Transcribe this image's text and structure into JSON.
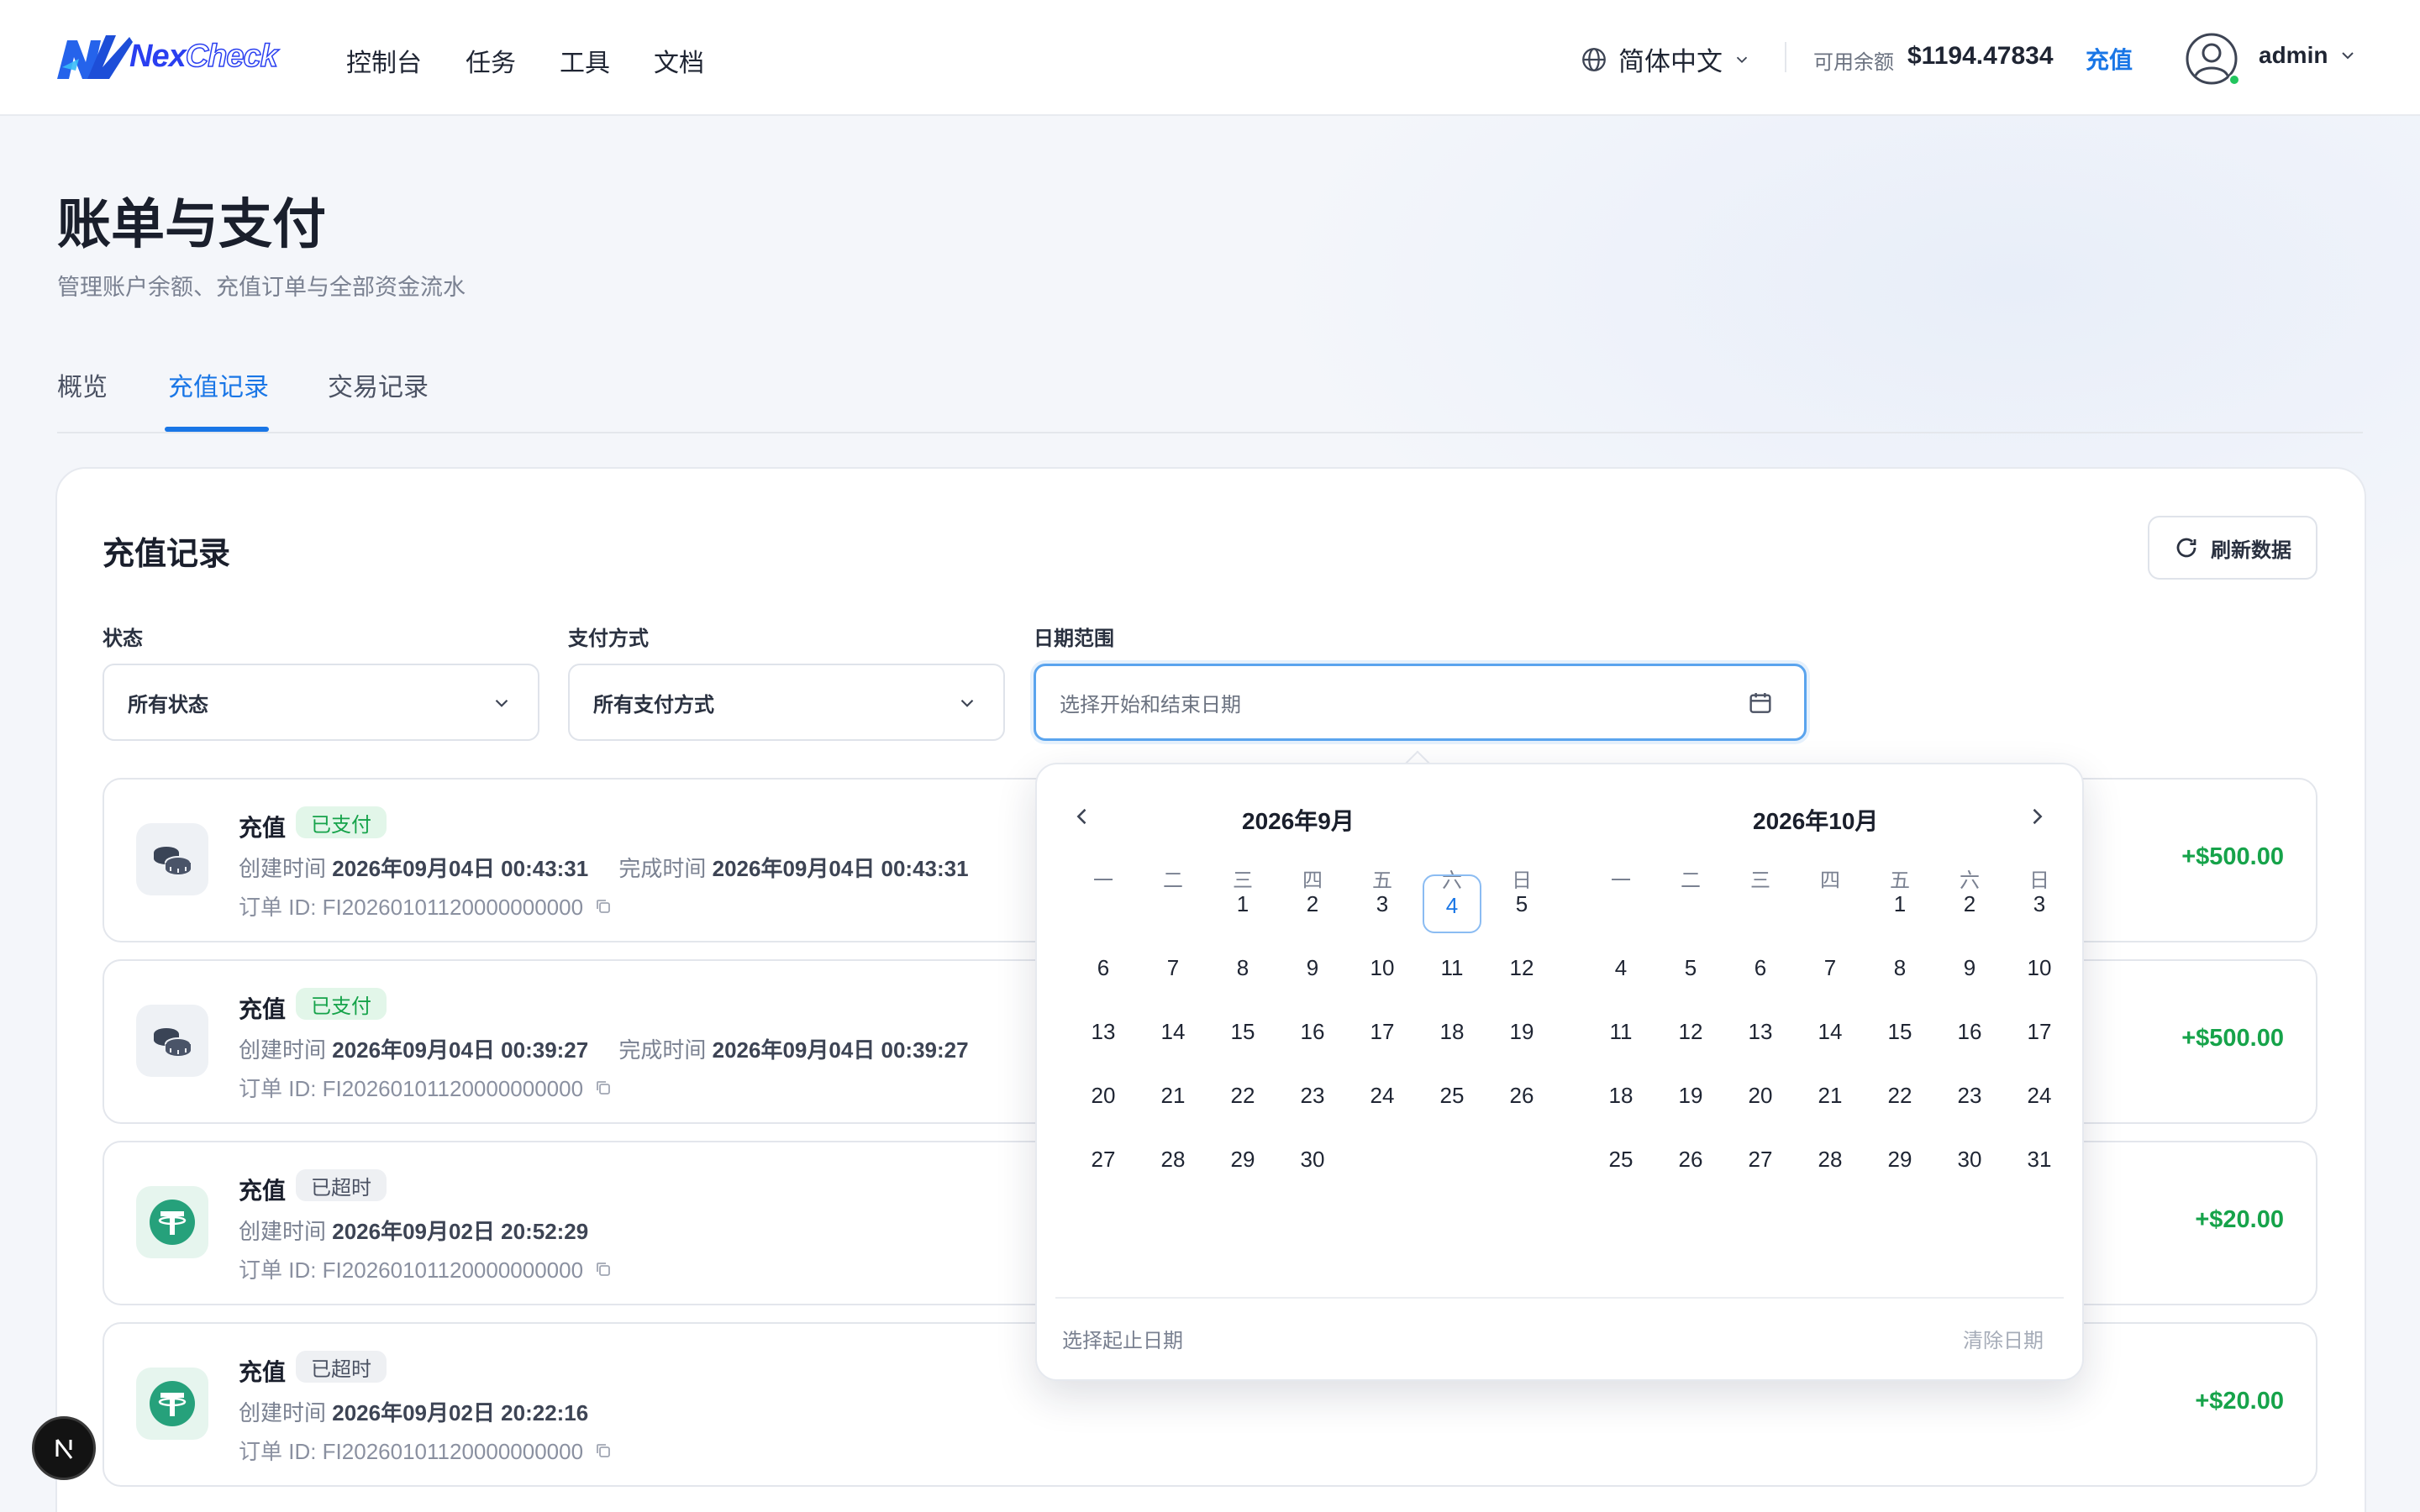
{
  "brand": {
    "name_part1": "Nex",
    "name_part2": "Check"
  },
  "nav": [
    "控制台",
    "任务",
    "工具",
    "文档"
  ],
  "language": "简体中文",
  "balance": {
    "label": "可用余额",
    "value": "$1194.47834",
    "recharge": "充值"
  },
  "user": {
    "name": "admin"
  },
  "page": {
    "title": "账单与支付",
    "subtitle": "管理账户余额、充值订单与全部资金流水"
  },
  "tabs": [
    {
      "label": "概览",
      "active": false
    },
    {
      "label": "充值记录",
      "active": true
    },
    {
      "label": "交易记录",
      "active": false
    }
  ],
  "card": {
    "title": "充值记录",
    "refresh": "刷新数据"
  },
  "filters": {
    "status": {
      "label": "状态",
      "value": "所有状态"
    },
    "payment": {
      "label": "支付方式",
      "value": "所有支付方式"
    },
    "date": {
      "label": "日期范围",
      "placeholder": "选择开始和结束日期"
    }
  },
  "records": [
    {
      "type": "充值",
      "status": "已支付",
      "status_kind": "paid",
      "icon": "coins-icon",
      "created_label": "创建时间",
      "created": "2026年09月04日 00:43:31",
      "completed_label": "完成时间",
      "completed": "2026年09月04日 00:43:31",
      "order_id": "订单 ID: FI20260101120000000000",
      "amount": "+$500.00"
    },
    {
      "type": "充值",
      "status": "已支付",
      "status_kind": "paid",
      "icon": "coins-icon",
      "created_label": "创建时间",
      "created": "2026年09月04日 00:39:27",
      "completed_label": "完成时间",
      "completed": "2026年09月04日 00:39:27",
      "order_id": "订单 ID: FI20260101120000000000",
      "amount": "+$500.00"
    },
    {
      "type": "充值",
      "status": "已超时",
      "status_kind": "timeout",
      "icon": "tether-icon",
      "created_label": "创建时间",
      "created": "2026年09月02日 20:52:29",
      "order_id": "订单 ID: FI20260101120000000000",
      "amount": "+$20.00"
    },
    {
      "type": "充值",
      "status": "已超时",
      "status_kind": "timeout",
      "icon": "tether-icon",
      "created_label": "创建时间",
      "created": "2026年09月02日 20:22:16",
      "order_id": "订单 ID: FI20260101120000000000",
      "amount": "+$20.00"
    }
  ],
  "calendar": {
    "weekdays": [
      "一",
      "二",
      "三",
      "四",
      "五",
      "六",
      "日"
    ],
    "months": [
      {
        "title": "2026年9月",
        "first_weekday": 2,
        "days": 30,
        "today": 4
      },
      {
        "title": "2026年10月",
        "first_weekday": 4,
        "days": 31
      }
    ],
    "hint": "选择起止日期",
    "clear": "清除日期"
  },
  "colors": {
    "accent": "#1976e6",
    "success": "#16a34a",
    "tether": "#26a17b"
  }
}
